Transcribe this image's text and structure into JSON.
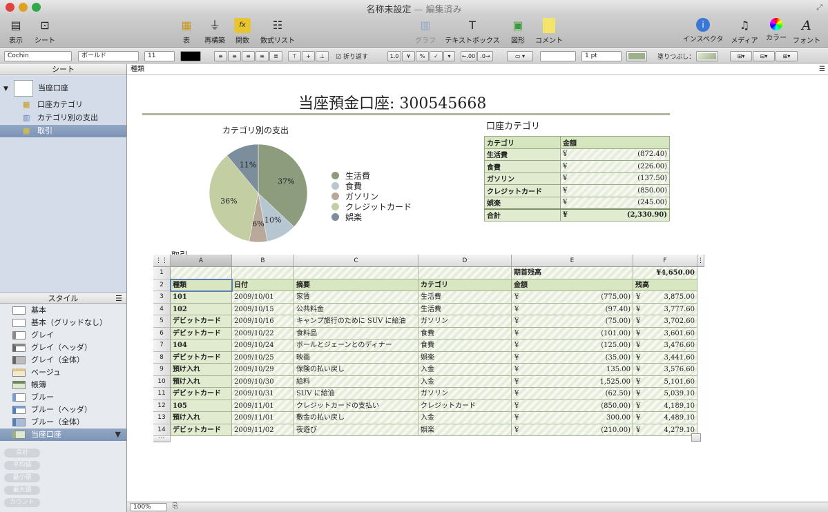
{
  "window": {
    "title": "名称未設定",
    "edited": "— 編集済み"
  },
  "toolbar": {
    "left": [
      {
        "label": "表示"
      },
      {
        "label": "シート"
      }
    ],
    "center": [
      {
        "label": "表"
      },
      {
        "label": "再構築"
      },
      {
        "label": "関数"
      },
      {
        "label": "数式リスト"
      }
    ],
    "insert": [
      {
        "label": "グラフ"
      },
      {
        "label": "テキストボックス"
      },
      {
        "label": "図形"
      },
      {
        "label": "コメント"
      }
    ],
    "right": [
      {
        "label": "インスペクタ"
      },
      {
        "label": "メディア"
      },
      {
        "label": "カラー"
      },
      {
        "label": "フォント"
      }
    ]
  },
  "format_bar": {
    "font": "Cochin",
    "weight": "ボールド",
    "size": "11",
    "wrap_label": "折り返す",
    "decimal_btn": "1.0",
    "yen_btn": "¥",
    "percent_btn": "%",
    "check_btn": "✓",
    "dec_up": "←.00",
    "dec_down": ".0→",
    "stroke": "1 pt",
    "fill_label": "塗りつぶし：",
    "colors": {
      "fill": "#9db08a"
    }
  },
  "formula_bar": {
    "content": "種類"
  },
  "sidebar": {
    "sheets_header": "シート",
    "sheet_name": "当座口座",
    "items": [
      {
        "label": "口座カテゴリ",
        "icon": "table-icon"
      },
      {
        "label": "カテゴリ別の支出",
        "icon": "chart-icon"
      },
      {
        "label": "取引",
        "icon": "table-icon"
      }
    ],
    "styles_header": "スタイル",
    "styles": [
      "基本",
      "基本（グリッドなし）",
      "グレイ",
      "グレイ（ヘッダ）",
      "グレイ（全体）",
      "ベージュ",
      "帳簿",
      "ブルー",
      "ブルー（ヘッダ）",
      "ブルー（全体）",
      "当座口座"
    ],
    "functions": [
      "合計",
      "平均値",
      "最小値",
      "最大値",
      "カウント"
    ]
  },
  "document": {
    "title": "当座預金口座: 300545668",
    "chart_title": "カテゴリ別の支出",
    "account_table_title": "口座カテゴリ",
    "transactions_label": "取引"
  },
  "chart_data": {
    "type": "pie",
    "title": "カテゴリ別の支出",
    "categories": [
      "生活費",
      "食費",
      "ガソリン",
      "クレジットカード",
      "娯楽"
    ],
    "values": [
      37,
      10,
      6,
      36,
      11
    ],
    "colors": [
      "#8e9c7e",
      "#b7c7d2",
      "#b8a99a",
      "#c4cea3",
      "#7c8e9c"
    ],
    "legend_position": "right"
  },
  "category_table": {
    "headers": [
      "カテゴリ",
      "金額"
    ],
    "rows": [
      {
        "name": "生活費",
        "yen": "¥",
        "amount": "(872.40)"
      },
      {
        "name": "食費",
        "yen": "¥",
        "amount": "(226.00)"
      },
      {
        "name": "ガソリン",
        "yen": "¥",
        "amount": "(137.50)"
      },
      {
        "name": "クレジットカード",
        "yen": "¥",
        "amount": "(850.00)"
      },
      {
        "name": "娯楽",
        "yen": "¥",
        "amount": "(245.00)"
      }
    ],
    "total": {
      "name": "合計",
      "yen": "¥",
      "amount": "(2,330.90)"
    }
  },
  "transactions": {
    "columns": [
      "A",
      "B",
      "C",
      "D",
      "E",
      "F"
    ],
    "opening_label": "期首残高",
    "opening_value": "¥4,650.00",
    "headers": [
      "種類",
      "日付",
      "摘要",
      "カテゴリ",
      "金額",
      "残高"
    ],
    "rows": [
      {
        "type": "101",
        "date": "2009/10/01",
        "desc": "家賃",
        "cat": "生活費",
        "amount": "(775.00)",
        "balance": "3,875.00"
      },
      {
        "type": "102",
        "date": "2009/10/15",
        "desc": "公共料金",
        "cat": "生活費",
        "amount": "(97.40)",
        "balance": "3,777.60"
      },
      {
        "type": "デビットカード",
        "date": "2009/10/16",
        "desc": "キャンプ旅行のために SUV に給油",
        "cat": "ガソリン",
        "amount": "(75.00)",
        "balance": "3,702.60"
      },
      {
        "type": "デビットカード",
        "date": "2009/10/22",
        "desc": "食料品",
        "cat": "食費",
        "amount": "(101.00)",
        "balance": "3,601.60"
      },
      {
        "type": "104",
        "date": "2009/10/24",
        "desc": "ボールとジェーンとのディナー",
        "cat": "食費",
        "amount": "(125.00)",
        "balance": "3,476.60"
      },
      {
        "type": "デビットカード",
        "date": "2009/10/25",
        "desc": "映画",
        "cat": "娯楽",
        "amount": "(35.00)",
        "balance": "3,441.60"
      },
      {
        "type": "預け入れ",
        "date": "2009/10/29",
        "desc": "保険の払い戻し",
        "cat": "入金",
        "amount": "135.00",
        "balance": "3,576.60"
      },
      {
        "type": "預け入れ",
        "date": "2009/10/30",
        "desc": "給料",
        "cat": "入金",
        "amount": "1,525.00",
        "balance": "5,101.60"
      },
      {
        "type": "デビットカード",
        "date": "2009/10/31",
        "desc": "SUV に給油",
        "cat": "ガソリン",
        "amount": "(62.50)",
        "balance": "5,039.10"
      },
      {
        "type": "105",
        "date": "2009/11/01",
        "desc": "クレジットカードの支払い",
        "cat": "クレジットカード",
        "amount": "(850.00)",
        "balance": "4,189.10"
      },
      {
        "type": "預け入れ",
        "date": "2009/11/01",
        "desc": "敷金の払い戻し",
        "cat": "入金",
        "amount": "300.00",
        "balance": "4,489.10"
      },
      {
        "type": "デビットカード",
        "date": "2009/11/02",
        "desc": "夜遊び",
        "cat": "娯楽",
        "amount": "(210.00)",
        "balance": "4,279.10"
      }
    ],
    "yen": "¥"
  },
  "status": {
    "zoom": "100%"
  }
}
